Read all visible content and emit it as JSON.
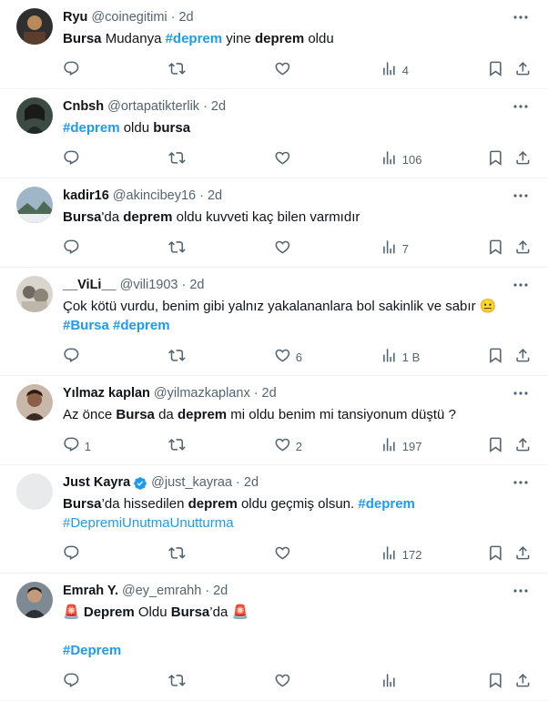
{
  "feed": {
    "tweets": [
      {
        "name": "Ryu",
        "handle": "@coinegitimi",
        "dot": "·",
        "time": "2d",
        "text": [
          {
            "t": "Bursa",
            "b": true
          },
          {
            "t": " Mudanya "
          },
          {
            "t": "#deprem",
            "h": true,
            "b": true
          },
          {
            "t": " yine "
          },
          {
            "t": "deprem",
            "b": true
          },
          {
            "t": " oldu"
          }
        ],
        "replies": "",
        "retweets": "",
        "likes": "",
        "views": "4",
        "verified": false,
        "avatar_color": "#3a3a3a"
      },
      {
        "name": "Cnbsh",
        "handle": "@ortapatikterlik",
        "dot": "·",
        "time": "2d",
        "text": [
          {
            "t": "#deprem",
            "h": true,
            "b": true
          },
          {
            "t": " oldu "
          },
          {
            "t": "bursa",
            "b": true
          }
        ],
        "replies": "",
        "retweets": "",
        "likes": "",
        "views": "106",
        "verified": false,
        "avatar_color": "#2c3a33"
      },
      {
        "name": "kadir16",
        "handle": "@akincibey16",
        "dot": "·",
        "time": "2d",
        "text": [
          {
            "t": "Bursa",
            "b": true
          },
          {
            "t": "'da "
          },
          {
            "t": "deprem",
            "b": true
          },
          {
            "t": " oldu kuvveti kaç bilen varmıdır"
          }
        ],
        "replies": "",
        "retweets": "",
        "likes": "",
        "views": "7",
        "verified": false,
        "avatar_color": "#8aa2b5"
      },
      {
        "name": "__ViLi__",
        "handle": "@vili1903",
        "dot": "·",
        "time": "2d",
        "text": [
          {
            "t": "Çok kötü vurdu, benim gibi yalnız yakalananlara bol sakinlik ve sabır 😐\n"
          },
          {
            "t": "#Bursa",
            "h": true,
            "b": true
          },
          {
            "t": " "
          },
          {
            "t": "#deprem",
            "h": true,
            "b": true
          }
        ],
        "replies": "",
        "retweets": "",
        "likes": "6",
        "views": "1 B",
        "verified": false,
        "avatar_color": "#c9c2b8"
      },
      {
        "name": "Yılmaz kaplan",
        "handle": "@yilmazkaplanx",
        "dot": "·",
        "time": "2d",
        "text": [
          {
            "t": "Az önce "
          },
          {
            "t": "Bursa",
            "b": true
          },
          {
            "t": " da "
          },
          {
            "t": "deprem",
            "b": true
          },
          {
            "t": " mi oldu benim mi tansiyonum düştü ?"
          }
        ],
        "replies": "1",
        "retweets": "",
        "likes": "2",
        "views": "197",
        "verified": false,
        "avatar_color": "#7a5a48"
      },
      {
        "name": "Just Kayra",
        "handle": "@just_kayraa",
        "dot": "·",
        "time": "2d",
        "text": [
          {
            "t": "Bursa",
            "b": true
          },
          {
            "t": "’da hissedilen "
          },
          {
            "t": "deprem",
            "b": true
          },
          {
            "t": " oldu geçmiş olsun. "
          },
          {
            "t": "#deprem",
            "h": true,
            "b": true
          },
          {
            "t": "\n"
          },
          {
            "t": "#DepremiUnutmaUnutturma",
            "h": true
          }
        ],
        "replies": "",
        "retweets": "",
        "likes": "",
        "views": "172",
        "verified": true,
        "avatar_color": "#e8eaec"
      },
      {
        "name": "Emrah Y.",
        "handle": "@ey_emrahh",
        "dot": "·",
        "time": "2d",
        "text": [
          {
            "t": "🚨 "
          },
          {
            "t": "Deprem",
            "b": true
          },
          {
            "t": " Oldu "
          },
          {
            "t": "Bursa",
            "b": true
          },
          {
            "t": "’da 🚨\n\n"
          },
          {
            "t": "#Deprem",
            "h": true,
            "b": true
          }
        ],
        "replies": "",
        "retweets": "",
        "likes": "",
        "views": "",
        "verified": false,
        "avatar_color": "#4a4f55"
      }
    ]
  },
  "colors": {
    "accent": "#1d9bf0",
    "muted": "#536471",
    "text": "#0f1419",
    "divider": "#eff3f4"
  },
  "icons": {
    "reply": "reply-icon",
    "retweet": "retweet-icon",
    "like": "heart-icon",
    "views": "views-icon",
    "bookmark": "bookmark-icon",
    "share": "share-icon",
    "more": "more-icon",
    "verified": "verified-badge-icon"
  }
}
